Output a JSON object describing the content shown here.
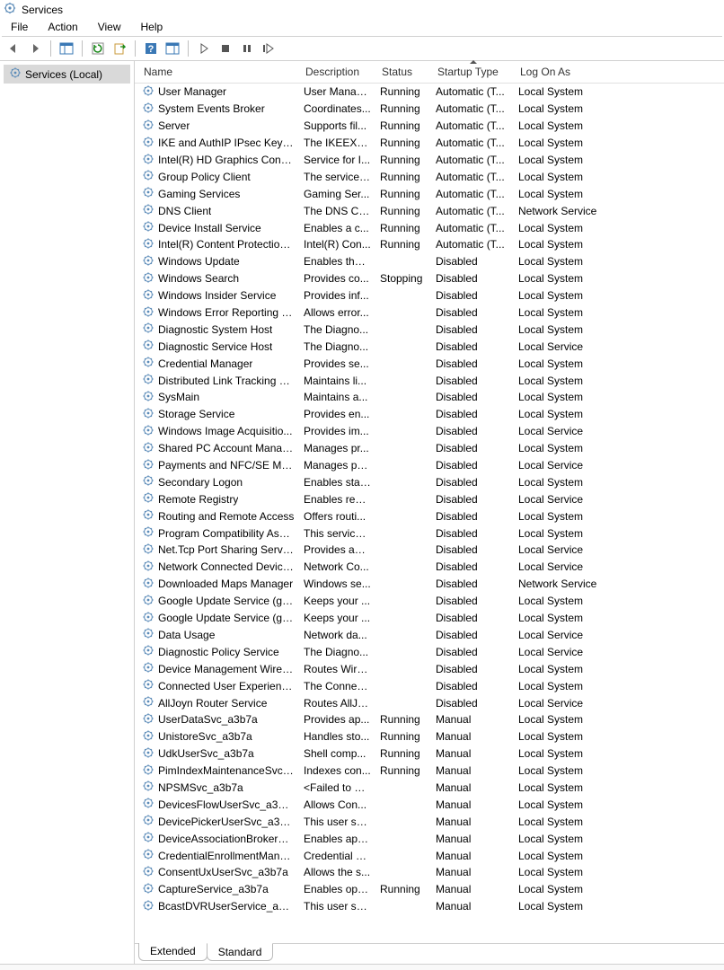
{
  "window": {
    "title": "Services"
  },
  "menu": {
    "file": "File",
    "action": "Action",
    "view": "View",
    "help": "Help"
  },
  "tree": {
    "root": "Services (Local)"
  },
  "columns": {
    "name": "Name",
    "description": "Description",
    "status": "Status",
    "startup": "Startup Type",
    "logon": "Log On As"
  },
  "tabs": {
    "extended": "Extended",
    "standard": "Standard"
  },
  "rows": [
    {
      "name": "User Manager",
      "desc": "User Manag...",
      "status": "Running",
      "startup": "Automatic (T...",
      "logon": "Local System"
    },
    {
      "name": "System Events Broker",
      "desc": "Coordinates...",
      "status": "Running",
      "startup": "Automatic (T...",
      "logon": "Local System"
    },
    {
      "name": "Server",
      "desc": "Supports fil...",
      "status": "Running",
      "startup": "Automatic (T...",
      "logon": "Local System"
    },
    {
      "name": "IKE and AuthIP IPsec Keying...",
      "desc": "The IKEEXT ...",
      "status": "Running",
      "startup": "Automatic (T...",
      "logon": "Local System"
    },
    {
      "name": "Intel(R) HD Graphics Contro...",
      "desc": "Service for I...",
      "status": "Running",
      "startup": "Automatic (T...",
      "logon": "Local System"
    },
    {
      "name": "Group Policy Client",
      "desc": "The service i...",
      "status": "Running",
      "startup": "Automatic (T...",
      "logon": "Local System"
    },
    {
      "name": "Gaming Services",
      "desc": "Gaming Ser...",
      "status": "Running",
      "startup": "Automatic (T...",
      "logon": "Local System"
    },
    {
      "name": "DNS Client",
      "desc": "The DNS Cli...",
      "status": "Running",
      "startup": "Automatic (T...",
      "logon": "Network Service"
    },
    {
      "name": "Device Install Service",
      "desc": "Enables a c...",
      "status": "Running",
      "startup": "Automatic (T...",
      "logon": "Local System"
    },
    {
      "name": "Intel(R) Content Protection ...",
      "desc": "Intel(R) Con...",
      "status": "Running",
      "startup": "Automatic (T...",
      "logon": "Local System"
    },
    {
      "name": "Windows Update",
      "desc": "Enables the ...",
      "status": "",
      "startup": "Disabled",
      "logon": "Local System"
    },
    {
      "name": "Windows Search",
      "desc": "Provides co...",
      "status": "Stopping",
      "startup": "Disabled",
      "logon": "Local System"
    },
    {
      "name": "Windows Insider Service",
      "desc": "Provides inf...",
      "status": "",
      "startup": "Disabled",
      "logon": "Local System"
    },
    {
      "name": "Windows Error Reporting Se...",
      "desc": "Allows error...",
      "status": "",
      "startup": "Disabled",
      "logon": "Local System"
    },
    {
      "name": "Diagnostic System Host",
      "desc": "The Diagno...",
      "status": "",
      "startup": "Disabled",
      "logon": "Local System"
    },
    {
      "name": "Diagnostic Service Host",
      "desc": "The Diagno...",
      "status": "",
      "startup": "Disabled",
      "logon": "Local Service"
    },
    {
      "name": "Credential Manager",
      "desc": "Provides se...",
      "status": "",
      "startup": "Disabled",
      "logon": "Local System"
    },
    {
      "name": "Distributed Link Tracking Cli...",
      "desc": "Maintains li...",
      "status": "",
      "startup": "Disabled",
      "logon": "Local System"
    },
    {
      "name": "SysMain",
      "desc": "Maintains a...",
      "status": "",
      "startup": "Disabled",
      "logon": "Local System"
    },
    {
      "name": "Storage Service",
      "desc": "Provides en...",
      "status": "",
      "startup": "Disabled",
      "logon": "Local System"
    },
    {
      "name": "Windows Image Acquisitio...",
      "desc": "Provides im...",
      "status": "",
      "startup": "Disabled",
      "logon": "Local Service"
    },
    {
      "name": "Shared PC Account Manager",
      "desc": "Manages pr...",
      "status": "",
      "startup": "Disabled",
      "logon": "Local System"
    },
    {
      "name": "Payments and NFC/SE Man...",
      "desc": "Manages pa...",
      "status": "",
      "startup": "Disabled",
      "logon": "Local Service"
    },
    {
      "name": "Secondary Logon",
      "desc": "Enables star...",
      "status": "",
      "startup": "Disabled",
      "logon": "Local System"
    },
    {
      "name": "Remote Registry",
      "desc": "Enables rem...",
      "status": "",
      "startup": "Disabled",
      "logon": "Local Service"
    },
    {
      "name": "Routing and Remote Access",
      "desc": "Offers routi...",
      "status": "",
      "startup": "Disabled",
      "logon": "Local System"
    },
    {
      "name": "Program Compatibility Assi...",
      "desc": "This service ...",
      "status": "",
      "startup": "Disabled",
      "logon": "Local System"
    },
    {
      "name": "Net.Tcp Port Sharing Service",
      "desc": "Provides abi...",
      "status": "",
      "startup": "Disabled",
      "logon": "Local Service"
    },
    {
      "name": "Network Connected Device...",
      "desc": "Network Co...",
      "status": "",
      "startup": "Disabled",
      "logon": "Local Service"
    },
    {
      "name": "Downloaded Maps Manager",
      "desc": "Windows se...",
      "status": "",
      "startup": "Disabled",
      "logon": "Network Service"
    },
    {
      "name": "Google Update Service (gup...",
      "desc": "Keeps your ...",
      "status": "",
      "startup": "Disabled",
      "logon": "Local System"
    },
    {
      "name": "Google Update Service (gup...",
      "desc": "Keeps your ...",
      "status": "",
      "startup": "Disabled",
      "logon": "Local System"
    },
    {
      "name": "Data Usage",
      "desc": "Network da...",
      "status": "",
      "startup": "Disabled",
      "logon": "Local Service"
    },
    {
      "name": "Diagnostic Policy Service",
      "desc": "The Diagno...",
      "status": "",
      "startup": "Disabled",
      "logon": "Local Service"
    },
    {
      "name": "Device Management Wirele...",
      "desc": "Routes Wire...",
      "status": "",
      "startup": "Disabled",
      "logon": "Local System"
    },
    {
      "name": "Connected User Experience...",
      "desc": "The Connec...",
      "status": "",
      "startup": "Disabled",
      "logon": "Local System"
    },
    {
      "name": "AllJoyn Router Service",
      "desc": "Routes AllJo...",
      "status": "",
      "startup": "Disabled",
      "logon": "Local Service"
    },
    {
      "name": "UserDataSvc_a3b7a",
      "desc": "Provides ap...",
      "status": "Running",
      "startup": "Manual",
      "logon": "Local System"
    },
    {
      "name": "UnistoreSvc_a3b7a",
      "desc": "Handles sto...",
      "status": "Running",
      "startup": "Manual",
      "logon": "Local System"
    },
    {
      "name": "UdkUserSvc_a3b7a",
      "desc": "Shell comp...",
      "status": "Running",
      "startup": "Manual",
      "logon": "Local System"
    },
    {
      "name": "PimIndexMaintenanceSvc_...",
      "desc": "Indexes con...",
      "status": "Running",
      "startup": "Manual",
      "logon": "Local System"
    },
    {
      "name": "NPSMSvc_a3b7a",
      "desc": "<Failed to R...",
      "status": "",
      "startup": "Manual",
      "logon": "Local System"
    },
    {
      "name": "DevicesFlowUserSvc_a3b7a",
      "desc": "Allows Con...",
      "status": "",
      "startup": "Manual",
      "logon": "Local System"
    },
    {
      "name": "DevicePickerUserSvc_a3b7a",
      "desc": "This user ser...",
      "status": "",
      "startup": "Manual",
      "logon": "Local System"
    },
    {
      "name": "DeviceAssociationBrokerSv...",
      "desc": "Enables app...",
      "status": "",
      "startup": "Manual",
      "logon": "Local System"
    },
    {
      "name": "CredentialEnrollmentMana...",
      "desc": "Credential E...",
      "status": "",
      "startup": "Manual",
      "logon": "Local System"
    },
    {
      "name": "ConsentUxUserSvc_a3b7a",
      "desc": "Allows the s...",
      "status": "",
      "startup": "Manual",
      "logon": "Local System"
    },
    {
      "name": "CaptureService_a3b7a",
      "desc": "Enables opti...",
      "status": "Running",
      "startup": "Manual",
      "logon": "Local System"
    },
    {
      "name": "BcastDVRUserService_a3b7a",
      "desc": "This user ser...",
      "status": "",
      "startup": "Manual",
      "logon": "Local System"
    }
  ]
}
